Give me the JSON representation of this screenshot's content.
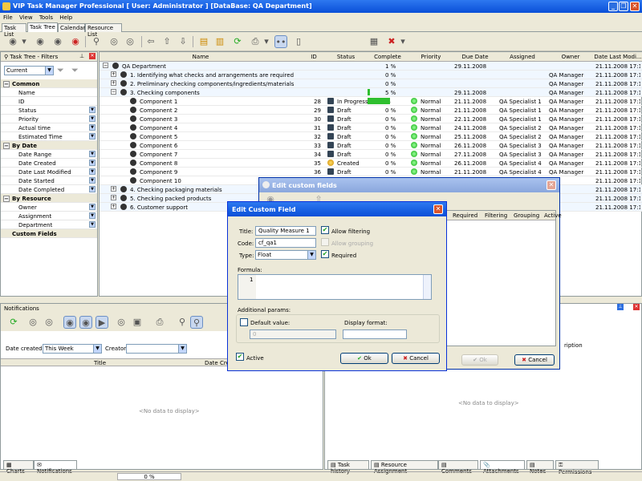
{
  "app": {
    "title": "VIP Task Manager Professional [ User: Administrator ] [DataBase: QA Department]"
  },
  "menu": [
    "File",
    "View",
    "Tools",
    "Help"
  ],
  "tabs": [
    "Task List",
    "Task Tree",
    "Calendar",
    "Resource List"
  ],
  "toolbar": {
    "page_value": "1"
  },
  "filters": {
    "panel_title": "Task Tree - Filters",
    "current": "Current",
    "groups": [
      {
        "label": "Common",
        "items": [
          "Name",
          "ID",
          "Status",
          "Priority",
          "Actual time",
          "Estimated Time"
        ]
      },
      {
        "label": "By Date",
        "items": [
          "Date Range",
          "Date Created",
          "Date Last Modified",
          "Date Started",
          "Date Completed"
        ]
      },
      {
        "label": "By Resource",
        "items": [
          "Owner",
          "Assignment",
          "Department"
        ]
      },
      {
        "label": "Custom Fields",
        "items": []
      }
    ]
  },
  "grid": {
    "columns": [
      "Name",
      "ID",
      "Status",
      "Complete",
      "Priority",
      "Due Date",
      "Assigned",
      "Owner",
      "Date Last Modi..."
    ],
    "rows": [
      {
        "name": "QA Department",
        "id": "",
        "status": "",
        "complete": "1 %",
        "priority": "",
        "due": "29.11.2008",
        "assigned": "",
        "owner": "",
        "modified": "21.11.2008 17:14"
      },
      {
        "name": "1. Identifying what checks and arrangements are required",
        "id": "",
        "status": "",
        "complete": "0 %",
        "priority": "",
        "due": "",
        "assigned": "",
        "owner": "QA Manager",
        "modified": "21.11.2008 17:12"
      },
      {
        "name": "2. Preliminary checking components/ingredients/materials",
        "id": "",
        "status": "",
        "complete": "0 %",
        "priority": "",
        "due": "",
        "assigned": "",
        "owner": "QA Manager",
        "modified": "21.11.2008 17:12"
      },
      {
        "name": "3. Checking components",
        "id": "",
        "status": "",
        "complete": "5 %",
        "priority": "",
        "due": "29.11.2008",
        "assigned": "",
        "owner": "QA Manager",
        "modified": "21.11.2008 17:14"
      },
      {
        "name": "Component 1",
        "id": "28",
        "status": "In Progress",
        "complete": "%",
        "priority": "Normal",
        "due": "21.11.2008",
        "assigned": "QA Specialist 1",
        "owner": "QA Manager",
        "modified": "21.11.2008 17:14"
      },
      {
        "name": "Component 2",
        "id": "29",
        "status": "Draft",
        "complete": "0 %",
        "priority": "Normal",
        "due": "21.11.2008",
        "assigned": "QA Specialist 1",
        "owner": "QA Manager",
        "modified": "21.11.2008 17:14"
      },
      {
        "name": "Component 3",
        "id": "30",
        "status": "Draft",
        "complete": "0 %",
        "priority": "Normal",
        "due": "22.11.2008",
        "assigned": "QA Specialist 1",
        "owner": "QA Manager",
        "modified": "21.11.2008 17:14"
      },
      {
        "name": "Component 4",
        "id": "31",
        "status": "Draft",
        "complete": "0 %",
        "priority": "Normal",
        "due": "24.11.2008",
        "assigned": "QA Specialist 2",
        "owner": "QA Manager",
        "modified": "21.11.2008 17:13"
      },
      {
        "name": "Component 5",
        "id": "32",
        "status": "Draft",
        "complete": "0 %",
        "priority": "Normal",
        "due": "25.11.2008",
        "assigned": "QA Specialist 2",
        "owner": "QA Manager",
        "modified": "21.11.2008 17:14"
      },
      {
        "name": "Component 6",
        "id": "33",
        "status": "Draft",
        "complete": "0 %",
        "priority": "Normal",
        "due": "26.11.2008",
        "assigned": "QA Specialist 3",
        "owner": "QA Manager",
        "modified": "21.11.2008 17:14"
      },
      {
        "name": "Component 7",
        "id": "34",
        "status": "Draft",
        "complete": "0 %",
        "priority": "Normal",
        "due": "27.11.2008",
        "assigned": "QA Specialist 3",
        "owner": "QA Manager",
        "modified": "21.11.2008 17:14"
      },
      {
        "name": "Component 8",
        "id": "35",
        "status": "Created",
        "complete": "0 %",
        "priority": "Normal",
        "due": "26.11.2008",
        "assigned": "QA Specialist 4",
        "owner": "QA Manager",
        "modified": "21.11.2008 17:14"
      },
      {
        "name": "Component 9",
        "id": "36",
        "status": "Draft",
        "complete": "0 %",
        "priority": "Normal",
        "due": "21.11.2008",
        "assigned": "QA Specialist 4",
        "owner": "QA Manager",
        "modified": "21.11.2008 17:14"
      },
      {
        "name": "Component 10",
        "id": "",
        "status": "",
        "complete": "",
        "priority": "",
        "due": "",
        "assigned": "",
        "owner": "",
        "modified": "21.11.2008 17:14"
      },
      {
        "name": "4. Checking packaging materials",
        "id": "",
        "status": "",
        "complete": "",
        "priority": "",
        "due": "",
        "assigned": "",
        "owner": "",
        "modified": "21.11.2008 17:12"
      },
      {
        "name": "5. Checking packed products",
        "id": "",
        "status": "",
        "complete": "",
        "priority": "",
        "due": "",
        "assigned": "",
        "owner": "",
        "modified": "21.11.2008 17:12"
      },
      {
        "name": "6. Customer support",
        "id": "",
        "status": "",
        "complete": "",
        "priority": "",
        "due": "",
        "assigned": "",
        "owner": "",
        "modified": "21.11.2008 17:12"
      }
    ]
  },
  "notifications": {
    "title": "Notifications",
    "date_created_label": "Date created:",
    "date_created_value": "This Week",
    "creator_label": "Creator:",
    "col_title": "Title",
    "col_date": "Date Crea",
    "empty": "<No data to display>"
  },
  "rightpanel": {
    "col": "ription",
    "empty": "<No data to display>"
  },
  "bottom_tabs_left": [
    "Charts",
    "Notifications"
  ],
  "bottom_tabs_right": [
    "Task history",
    "Resource Assignment",
    "Comments",
    "Attachments",
    "Notes",
    "Permissions"
  ],
  "statusbar": {
    "progress": "0 %"
  },
  "edit_custom_fields": {
    "title": "Edit custom fields",
    "columns": [
      "Required",
      "Filtering",
      "Grouping",
      "Active"
    ],
    "ok": "Ok",
    "cancel": "Cancel"
  },
  "dialog": {
    "title": "Edit Custom Field",
    "title_label": "Title:",
    "title_value": "Quality Measure 1",
    "code_label": "Code:",
    "code_value": "cf_qa1",
    "type_label": "Type:",
    "type_value": "Float",
    "allow_filtering": "Allow filtering",
    "allow_grouping": "Allow grouping",
    "required": "Required",
    "formula_label": "Formula:",
    "formula_line": "1",
    "additional_params": "Additional params:",
    "default_value": "Default value:",
    "default_num": "0",
    "display_format": "Display format:",
    "active": "Active",
    "ok": "Ok",
    "cancel": "Cancel"
  }
}
